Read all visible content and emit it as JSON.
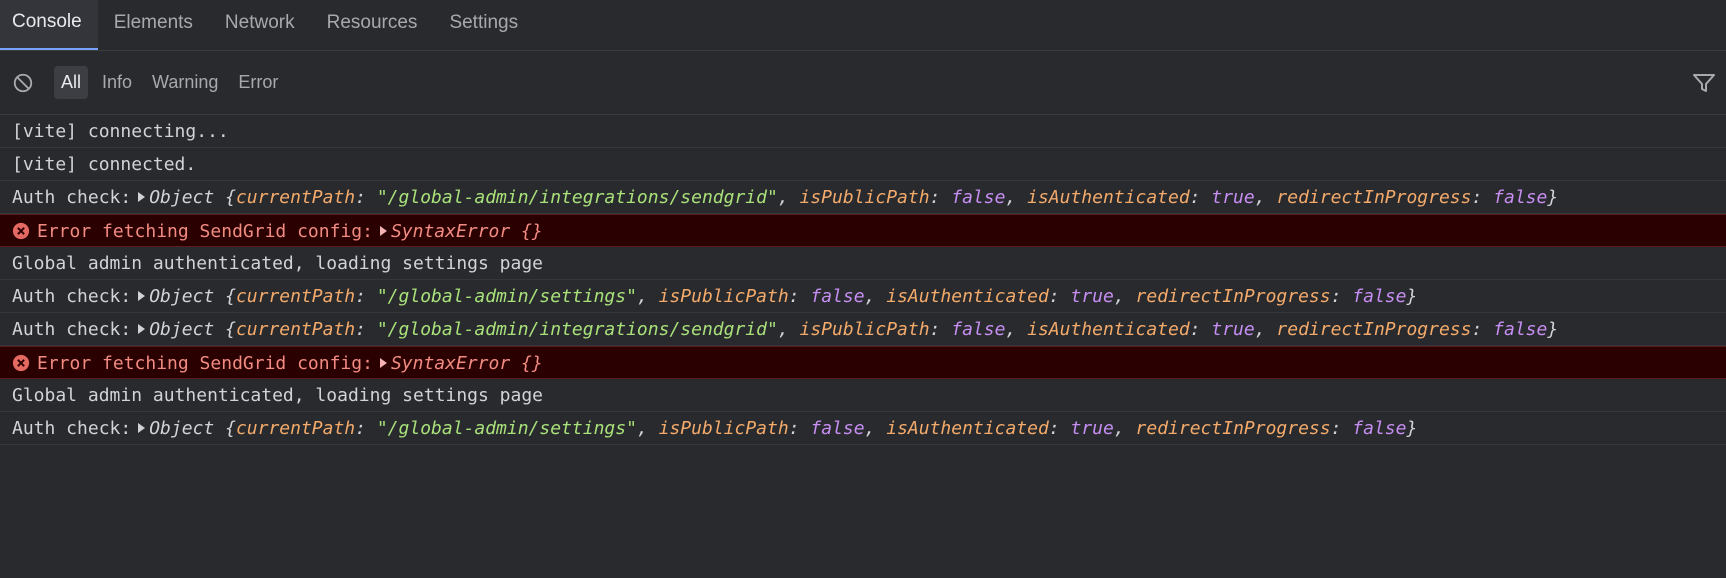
{
  "tabs": [
    {
      "label": "Console",
      "active": true
    },
    {
      "label": "Elements",
      "active": false
    },
    {
      "label": "Network",
      "active": false
    },
    {
      "label": "Resources",
      "active": false
    },
    {
      "label": "Settings",
      "active": false
    }
  ],
  "toolbar": {
    "filters": [
      "All",
      "Info",
      "Warning",
      "Error"
    ],
    "active_filter": "All",
    "clear_icon": "clear-console-icon",
    "filter_icon": "filter-icon"
  },
  "colors": {
    "accent": "#7aa3ff",
    "key": "#f3aa6b",
    "string": "#a8e07a",
    "boolean": "#c68ef3",
    "error_bg": "#2b0000",
    "error_text": "#f28b82"
  },
  "logs": [
    {
      "type": "text",
      "text": "[vite] connecting..."
    },
    {
      "type": "text",
      "text": "[vite] connected."
    },
    {
      "type": "auth",
      "prefix": "Auth check:",
      "object_label": "Object",
      "currentPath": "\"/global-admin/integrations/sendgrid\"",
      "isPublicPath": "false",
      "isAuthenticated": "true",
      "redirectInProgress": "false"
    },
    {
      "type": "error",
      "text": "Error fetching SendGrid config:",
      "error_type": "SyntaxError",
      "braces": "{}"
    },
    {
      "type": "text",
      "text": "Global admin authenticated, loading settings page"
    },
    {
      "type": "auth",
      "prefix": "Auth check:",
      "object_label": "Object",
      "currentPath": "\"/global-admin/settings\"",
      "isPublicPath": "false",
      "isAuthenticated": "true",
      "redirectInProgress": "false"
    },
    {
      "type": "auth",
      "prefix": "Auth check:",
      "object_label": "Object",
      "currentPath": "\"/global-admin/integrations/sendgrid\"",
      "isPublicPath": "false",
      "isAuthenticated": "true",
      "redirectInProgress": "false"
    },
    {
      "type": "error",
      "text": "Error fetching SendGrid config:",
      "error_type": "SyntaxError",
      "braces": "{}"
    },
    {
      "type": "text",
      "text": "Global admin authenticated, loading settings page"
    },
    {
      "type": "auth",
      "prefix": "Auth check:",
      "object_label": "Object",
      "currentPath": "\"/global-admin/settings\"",
      "isPublicPath": "false",
      "isAuthenticated": "true",
      "redirectInProgress": "false"
    }
  ]
}
